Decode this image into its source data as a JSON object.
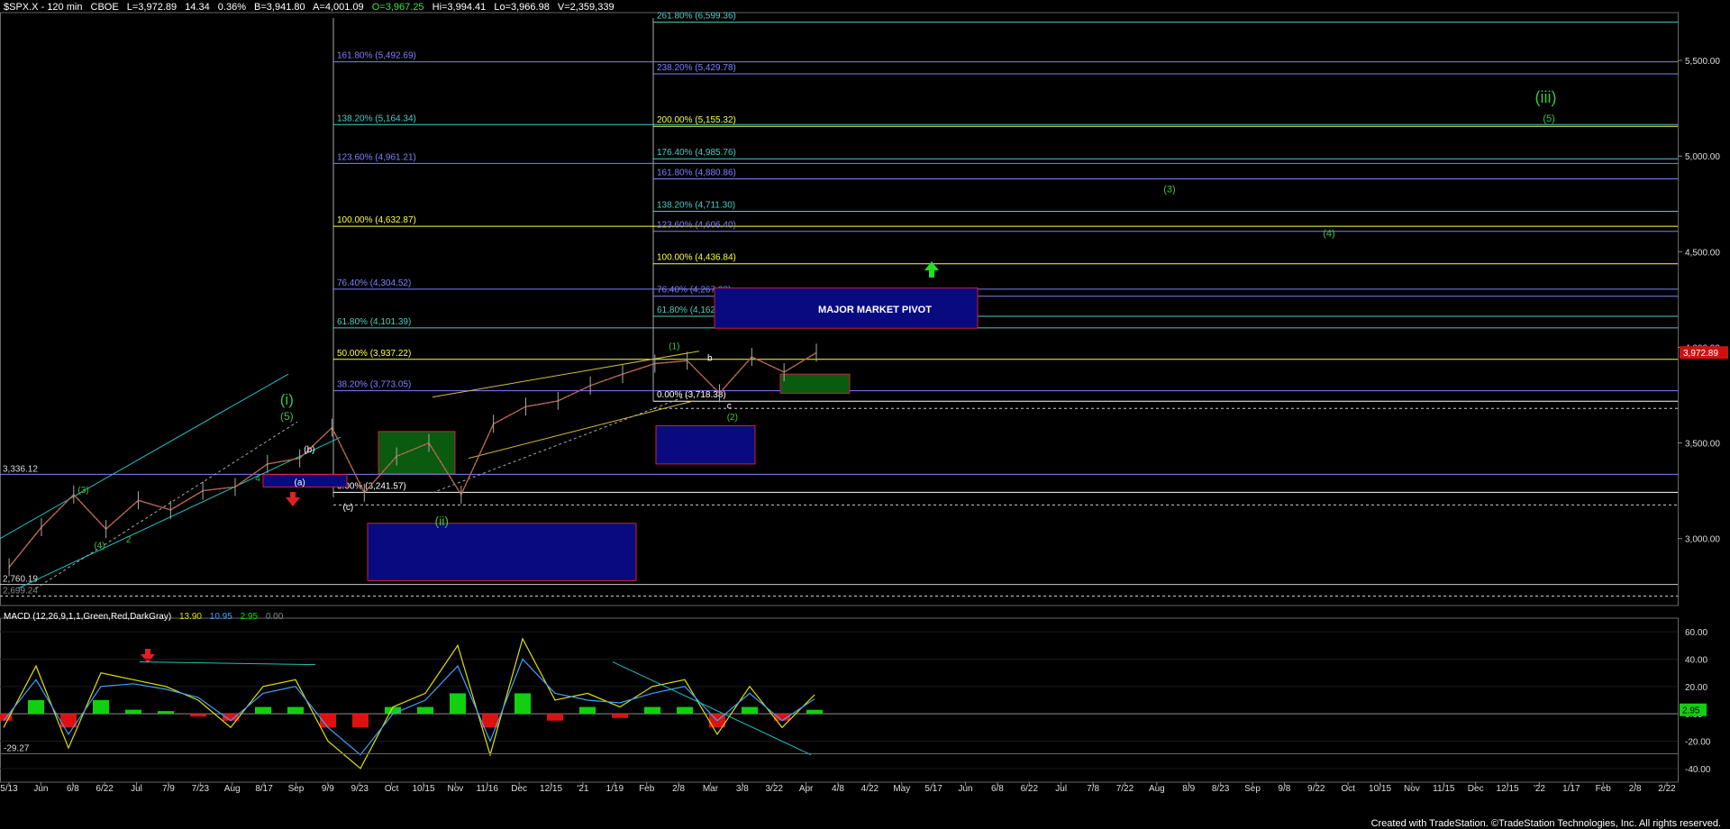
{
  "header": {
    "symbol": "$SPX.X - 120 min",
    "exchange": "CBOE",
    "last": "L=3,972.89",
    "change": "14.34",
    "change_pct": "0.36%",
    "bid": "B=3,941.80",
    "ask": "A=4,001.09",
    "open": "O=3,967.25",
    "high": "Hi=3,994.41",
    "low": "Lo=3,966.98",
    "volume": "V=2,359,339"
  },
  "macd_header": {
    "label": "MACD (12,26,9,1,1,Green,Red,DarkGray)",
    "v1": "13.90",
    "v2": "10.95",
    "v3": "2.95",
    "v4": "0.00",
    "colors": {
      "label": "#ffffff",
      "v1": "#e0e000",
      "v2": "#40a0ff",
      "v3": "#00e000",
      "v4": "#888888"
    }
  },
  "footer": "Created with TradeStation. ©TradeStation Technologies, Inc. All rights reserved.",
  "chart_data": {
    "type": "line",
    "title": "$SPX.X - 120 min",
    "xlabel": "",
    "ylabel": "",
    "ylim": [
      2650,
      5750
    ],
    "x_tick_labels": [
      "5/13",
      "Jun",
      "6/8",
      "6/22",
      "Jul",
      "7/9",
      "7/23",
      "Aug",
      "8/17",
      "Sep",
      "9/9",
      "9/23",
      "Oct",
      "10/15",
      "Nov",
      "11/16",
      "Dec",
      "12/15",
      "'21",
      "1/19",
      "Feb",
      "2/8",
      "Mar",
      "3/8",
      "3/22",
      "Apr",
      "4/8",
      "4/22",
      "May",
      "5/17",
      "Jun",
      "6/8",
      "6/22",
      "Jul",
      "7/8",
      "7/22",
      "Aug",
      "8/9",
      "8/23",
      "Sep",
      "9/8",
      "9/22",
      "Oct",
      "10/15",
      "Nov",
      "11/15",
      "Dec",
      "12/15",
      "'22",
      "1/17",
      "Feb",
      "2/8",
      "2/22"
    ],
    "y_tick_labels": [
      "5,500.00",
      "5,000.00",
      "4,500.00",
      "4,000.00",
      "3,500.00",
      "3,000.00"
    ],
    "y_ticks": [
      5500,
      5000,
      4500,
      4000,
      3500,
      3000
    ],
    "last_price_label": "3,972.89",
    "price_series": {
      "name": "",
      "dates": [
        "5/13",
        "Jun",
        "6/8",
        "6/22",
        "Jul",
        "7/9",
        "7/23",
        "Aug",
        "8/17",
        "Sep",
        "9/9",
        "9/23",
        "Oct",
        "10/15",
        "Nov",
        "11/16",
        "Dec",
        "12/15",
        "'21",
        "1/19",
        "Feb",
        "2/8",
        "Mar",
        "3/8",
        "3/22",
        "Apr"
      ],
      "values": [
        2850,
        3060,
        3230,
        3050,
        3200,
        3150,
        3250,
        3270,
        3390,
        3420,
        3580,
        3240,
        3430,
        3500,
        3230,
        3600,
        3690,
        3720,
        3800,
        3860,
        3915,
        3930,
        3760,
        3950,
        3870,
        3972
      ]
    },
    "left_fib": [
      {
        "label": "161.80% (5,492.69)",
        "value": 5492.69,
        "color": "#8080ff"
      },
      {
        "label": "138.20% (5,164.34)",
        "value": 5164.34,
        "color": "#4ecdc4"
      },
      {
        "label": "123.60% (4,961.21)",
        "value": 4961.21,
        "color": "#8080ff"
      },
      {
        "label": "100.00% (4,632.87)",
        "value": 4632.87,
        "color": "#ffff40"
      },
      {
        "label": "76.40% (4,304.52)",
        "value": 4304.52,
        "color": "#8080ff"
      },
      {
        "label": "61.80% (4,101.39)",
        "value": 4101.39,
        "color": "#4ecdc4"
      },
      {
        "label": "50.00% (3,937.22)",
        "value": 3937.22,
        "color": "#ffff40"
      },
      {
        "label": "38.20% (3,773.05)",
        "value": 3773.05,
        "color": "#8080ff"
      },
      {
        "label": "0.00% (3,241.57)",
        "value": 3241.57,
        "color": "#ffffff"
      }
    ],
    "right_fib": [
      {
        "label": "261.80% (6,599.36)",
        "value": 5700,
        "color": "#4ecdc4"
      },
      {
        "label": "238.20% (5,429.78)",
        "value": 5429.78,
        "color": "#8080ff"
      },
      {
        "label": "200.00% (5,155.32)",
        "value": 5155.32,
        "color": "#ffff40"
      },
      {
        "label": "176.40% (4,985.76)",
        "value": 4985.76,
        "color": "#4ecdc4"
      },
      {
        "label": "161.80% (4,880.86)",
        "value": 4880.86,
        "color": "#8080ff"
      },
      {
        "label": "138.20% (4,711.30)",
        "value": 4711.3,
        "color": "#4ecdc4"
      },
      {
        "label": "123.60% (4,606.40)",
        "value": 4606.4,
        "color": "#8080ff"
      },
      {
        "label": "100.00% (4,436.84)",
        "value": 4436.84,
        "color": "#ffff40"
      },
      {
        "label": "76.40% (4,267.28)",
        "value": 4267.28,
        "color": "#8080ff"
      },
      {
        "label": "61.80% (4,162.38)",
        "value": 4162.38,
        "color": "#4ecdc4"
      },
      {
        "label": "0.00% (3,718.38)",
        "value": 3718.38,
        "color": "#ffffff"
      }
    ],
    "extra_levels": [
      {
        "label": "3,336.12",
        "value": 3336.12
      },
      {
        "label": "2,760.19",
        "value": 2760.19
      },
      {
        "label": "2,699.24",
        "value": 2699.24
      }
    ],
    "annotations": [
      {
        "text": "(i)",
        "color": "#40c040",
        "date_index": 8.6,
        "value": 3700,
        "size": 17
      },
      {
        "text": "(5)",
        "color": "#40c040",
        "date_index": 8.6,
        "value": 3620,
        "size": 12
      },
      {
        "text": "(3)",
        "color": "#40c040",
        "date_index": 2.3,
        "value": 3240,
        "size": 10
      },
      {
        "text": "(4)",
        "color": "#40c040",
        "date_index": 2.8,
        "value": 2950,
        "size": 10
      },
      {
        "text": "2",
        "color": "#40c040",
        "date_index": 3.7,
        "value": 2980,
        "size": 10
      },
      {
        "text": "4",
        "color": "#40c040",
        "date_index": 7.7,
        "value": 3300,
        "size": 10
      },
      {
        "text": "(b)",
        "color": "#ffffff",
        "date_index": 9.3,
        "value": 3450,
        "size": 10
      },
      {
        "text": "(a)",
        "color": "#ffffff",
        "date_index": 9.0,
        "value": 3280,
        "size": 10
      },
      {
        "text": "(c)",
        "color": "#ffffff",
        "date_index": 10.5,
        "value": 3150,
        "size": 10
      },
      {
        "text": "(ii)",
        "color": "#40c040",
        "date_index": 13.4,
        "value": 3070,
        "size": 14
      },
      {
        "text": "(1)",
        "color": "#40c040",
        "date_index": 20.6,
        "value": 3990,
        "size": 10
      },
      {
        "text": "b",
        "color": "#ffffff",
        "date_index": 21.7,
        "value": 3930,
        "size": 10
      },
      {
        "text": "c",
        "color": "#ffffff",
        "date_index": 22.3,
        "value": 3680,
        "size": 10
      },
      {
        "text": "(2)",
        "color": "#40c040",
        "date_index": 22.4,
        "value": 3620,
        "size": 10
      },
      {
        "text": "(3)",
        "color": "#40c040",
        "date_index": 36.4,
        "value": 4810,
        "size": 11
      },
      {
        "text": "(4)",
        "color": "#40c040",
        "date_index": 41.4,
        "value": 4580,
        "size": 11
      },
      {
        "text": "(iii)",
        "color": "#40c040",
        "date_index": 48.2,
        "value": 5280,
        "size": 18
      },
      {
        "text": "(5)",
        "color": "#40c040",
        "date_index": 48.3,
        "value": 5180,
        "size": 11
      }
    ],
    "pivot_label": "MAJOR MARKET PIVOT",
    "macd": {
      "y_tick_labels": [
        "60.00",
        "40.00",
        "20.00",
        "0.00",
        "-20.00",
        "-40.00"
      ],
      "y_ticks": [
        60,
        40,
        20,
        0,
        -20,
        -40
      ],
      "ylim": [
        -50,
        70
      ],
      "min_label": "-29.27",
      "last_label": "2.95",
      "macd_line": [
        -10,
        35,
        -25,
        30,
        25,
        20,
        10,
        -10,
        20,
        25,
        -20,
        -40,
        5,
        15,
        50,
        -30,
        55,
        10,
        15,
        5,
        20,
        25,
        -15,
        20,
        -10,
        13.9
      ],
      "signal_line": [
        -5,
        25,
        -15,
        20,
        22,
        18,
        12,
        -5,
        15,
        20,
        -10,
        -30,
        0,
        10,
        35,
        -20,
        40,
        15,
        10,
        8,
        15,
        20,
        -5,
        15,
        -5,
        10.95
      ]
    }
  }
}
